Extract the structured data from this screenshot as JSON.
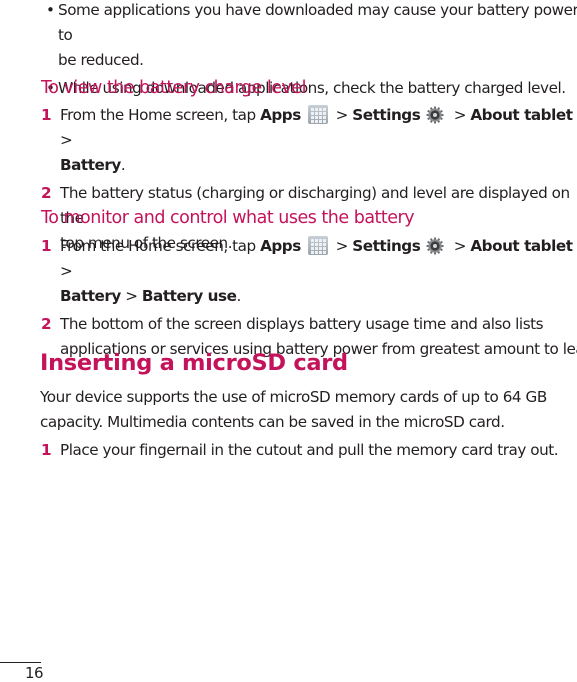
{
  "bullets": [
    {
      "text_line1": "Some applications you have downloaded may cause your battery power to",
      "text_line2": "be reduced."
    },
    {
      "text_line1": "While using downloaded applications, check the battery charged level."
    }
  ],
  "section_view": {
    "title": "To view the battery charge level",
    "steps": [
      {
        "num": "1",
        "prefix": "From the Home screen, tap ",
        "apps": "Apps",
        "sep": " > ",
        "settings": "Settings",
        "about": "About tablet",
        "battery": "Battery",
        "end": "."
      },
      {
        "num": "2",
        "line1": "The battery status (charging or discharging) and level are displayed on the",
        "line2": "top menu of the screen."
      }
    ]
  },
  "section_monitor": {
    "title": "To monitor and control what uses the battery",
    "steps": [
      {
        "num": "1",
        "prefix": "From the Home screen, tap ",
        "apps": "Apps",
        "sep": " > ",
        "settings": "Settings",
        "about": "About tablet",
        "battery": "Battery",
        "battery_use": "Battery use",
        "end": "."
      },
      {
        "num": "2",
        "line1": "The bottom of the screen displays battery usage time and also lists",
        "line2": "applications or services using battery power from greatest amount to least."
      }
    ]
  },
  "microsd": {
    "heading": "Inserting a microSD card",
    "para_line1": "Your device supports the use of microSD memory cards of up to 64 GB",
    "para_line2": "capacity. Multimedia contents can be saved in the microSD card.",
    "steps": [
      {
        "num": "1",
        "text": "Place your fingernail in the cutout and pull the memory card tray out."
      }
    ]
  },
  "icons": {
    "apps": "apps-grid-icon",
    "settings": "settings-gear-icon"
  },
  "page_number": "16",
  "colors": {
    "accent": "#c4135a",
    "text": "#231f20"
  }
}
